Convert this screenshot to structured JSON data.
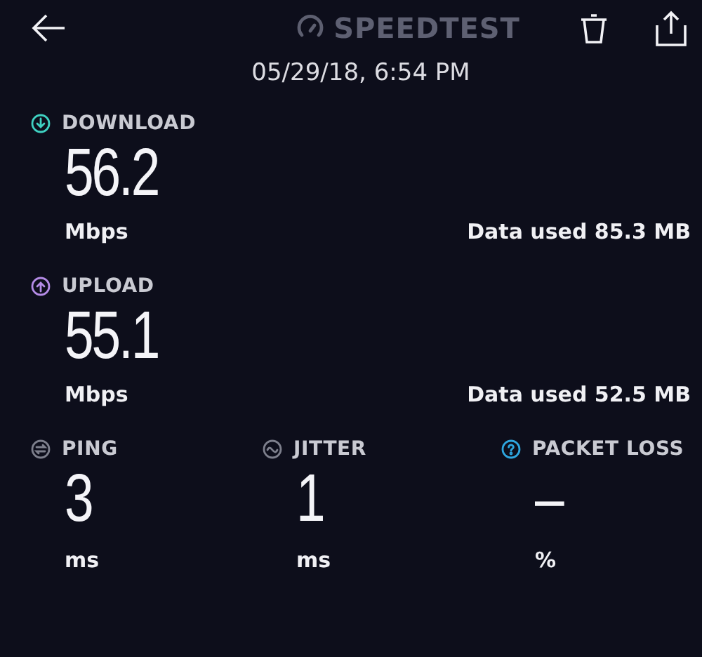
{
  "header": {
    "title": "SPEEDTEST",
    "date": "05/29/18, 6:54 PM"
  },
  "speeds": [
    {
      "kind": "download",
      "label": "DOWNLOAD",
      "color": "#3fd1c2",
      "value": "56.2",
      "unit": "Mbps",
      "data_used": "Data used 85.3 MB"
    },
    {
      "kind": "upload",
      "label": "UPLOAD",
      "color": "#b48be6",
      "value": "55.1",
      "unit": "Mbps",
      "data_used": "Data used 52.5 MB"
    }
  ],
  "metrics": [
    {
      "kind": "ping",
      "label": "PING",
      "color": "#7d7f8c",
      "value": "3",
      "unit": "ms"
    },
    {
      "kind": "jitter",
      "label": "JITTER",
      "color": "#7d7f8c",
      "value": "1",
      "unit": "ms"
    },
    {
      "kind": "packet_loss",
      "label": "PACKET LOSS",
      "color": "#2ea6df",
      "value": "–",
      "unit": "%"
    }
  ]
}
